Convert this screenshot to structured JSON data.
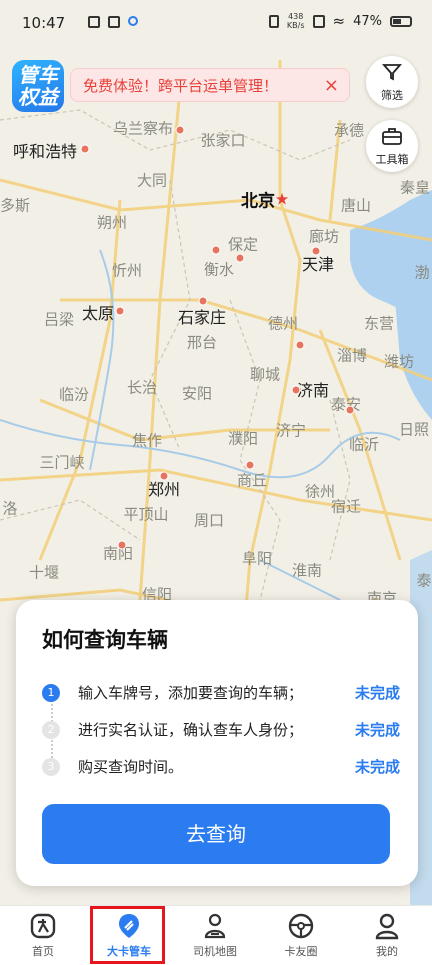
{
  "status_bar": {
    "time": "10:47",
    "speed_top": "438",
    "speed_bottom": "KB/s",
    "battery": "47%"
  },
  "promo": {
    "logo_text_1": "管车",
    "logo_text_2": "权益",
    "text": "免费体验！跨平台运单管理！",
    "close": "×"
  },
  "side_buttons": [
    {
      "label": "筛选",
      "icon": "filter-icon"
    },
    {
      "label": "工具箱",
      "icon": "toolbox-icon"
    }
  ],
  "map": {
    "cities": [
      {
        "name": "乌兰察布"
      },
      {
        "name": "张家口"
      },
      {
        "name": "承德"
      },
      {
        "name": "呼和浩特"
      },
      {
        "name": "大同"
      },
      {
        "name": "北京"
      },
      {
        "name": "唐山"
      },
      {
        "name": "秦皇"
      },
      {
        "name": "多斯"
      },
      {
        "name": "朔州"
      },
      {
        "name": "保定"
      },
      {
        "name": "廊坊"
      },
      {
        "name": "天津"
      },
      {
        "name": "渤"
      },
      {
        "name": "忻州"
      },
      {
        "name": "衡水"
      },
      {
        "name": "太原"
      },
      {
        "name": "石家庄"
      },
      {
        "name": "吕梁"
      },
      {
        "name": "德州"
      },
      {
        "name": "东营"
      },
      {
        "name": "邢台"
      },
      {
        "name": "淄博"
      },
      {
        "name": "潍坊"
      },
      {
        "name": "聊城"
      },
      {
        "name": "长治"
      },
      {
        "name": "临汾"
      },
      {
        "name": "济南"
      },
      {
        "name": "安阳"
      },
      {
        "name": "泰安"
      },
      {
        "name": "焦作"
      },
      {
        "name": "濮阳"
      },
      {
        "name": "济宁"
      },
      {
        "name": "临沂"
      },
      {
        "name": "日照"
      },
      {
        "name": "三门峡"
      },
      {
        "name": "郑州"
      },
      {
        "name": "商丘"
      },
      {
        "name": "徐州"
      },
      {
        "name": "洛"
      },
      {
        "name": "平顶山"
      },
      {
        "name": "宿迁"
      },
      {
        "name": "周口"
      },
      {
        "name": "南阳"
      },
      {
        "name": "阜阳"
      },
      {
        "name": "淮南"
      },
      {
        "name": "十堰"
      },
      {
        "name": "信阳"
      },
      {
        "name": "南京"
      },
      {
        "name": "泰"
      }
    ]
  },
  "card": {
    "title": "如何查询车辆",
    "steps": [
      {
        "num": "1",
        "text": "输入车牌号，添加要查询的车辆；",
        "status": "未完成"
      },
      {
        "num": "2",
        "text": "进行实名认证，确认查车人身份；",
        "status": "未完成"
      },
      {
        "num": "3",
        "text": "购买查询时间。",
        "status": "未完成"
      }
    ],
    "button": "去查询"
  },
  "tabs": [
    {
      "label": "首页",
      "icon": "home-icon"
    },
    {
      "label": "大卡管车",
      "icon": "truck-manage-icon",
      "active": true
    },
    {
      "label": "司机地图",
      "icon": "driver-map-icon"
    },
    {
      "label": "卡友圈",
      "icon": "steering-wheel-icon"
    },
    {
      "label": "我的",
      "icon": "profile-icon"
    }
  ],
  "colors": {
    "accent": "#2a7cf0",
    "promo_text": "#e8413b",
    "highlight": "#e5161d"
  }
}
